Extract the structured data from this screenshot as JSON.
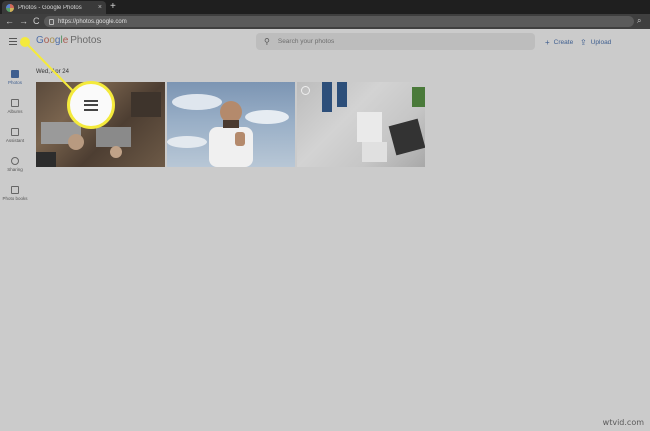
{
  "browser": {
    "tab_title": "Photos - Google Photos",
    "tab_close": "×",
    "new_tab": "+",
    "url": "https://photos.google.com",
    "back": "←",
    "forward": "→",
    "reload": "C"
  },
  "header": {
    "logo_word": "Google",
    "product": "Photos",
    "search_placeholder": "Search your photos",
    "create_label": "Create",
    "upload_label": "Upload"
  },
  "sidebar": {
    "items": [
      {
        "label": "Photos",
        "icon": "photo-icon"
      },
      {
        "label": "Albums",
        "icon": "albums-icon"
      },
      {
        "label": "Assistant",
        "icon": "assistant-icon"
      },
      {
        "label": "Sharing",
        "icon": "sharing-icon"
      },
      {
        "label": "Photo books",
        "icon": "photo-book-icon"
      }
    ]
  },
  "main": {
    "date_heading": "Wed, Apr 24",
    "photos": [
      {
        "description": "team hands with laptops"
      },
      {
        "description": "man thumbs up sky"
      },
      {
        "description": "desk top view"
      }
    ]
  },
  "highlight": {
    "target": "main menu button",
    "color": "#f4ea3c"
  },
  "watermark": "wtvid.com"
}
